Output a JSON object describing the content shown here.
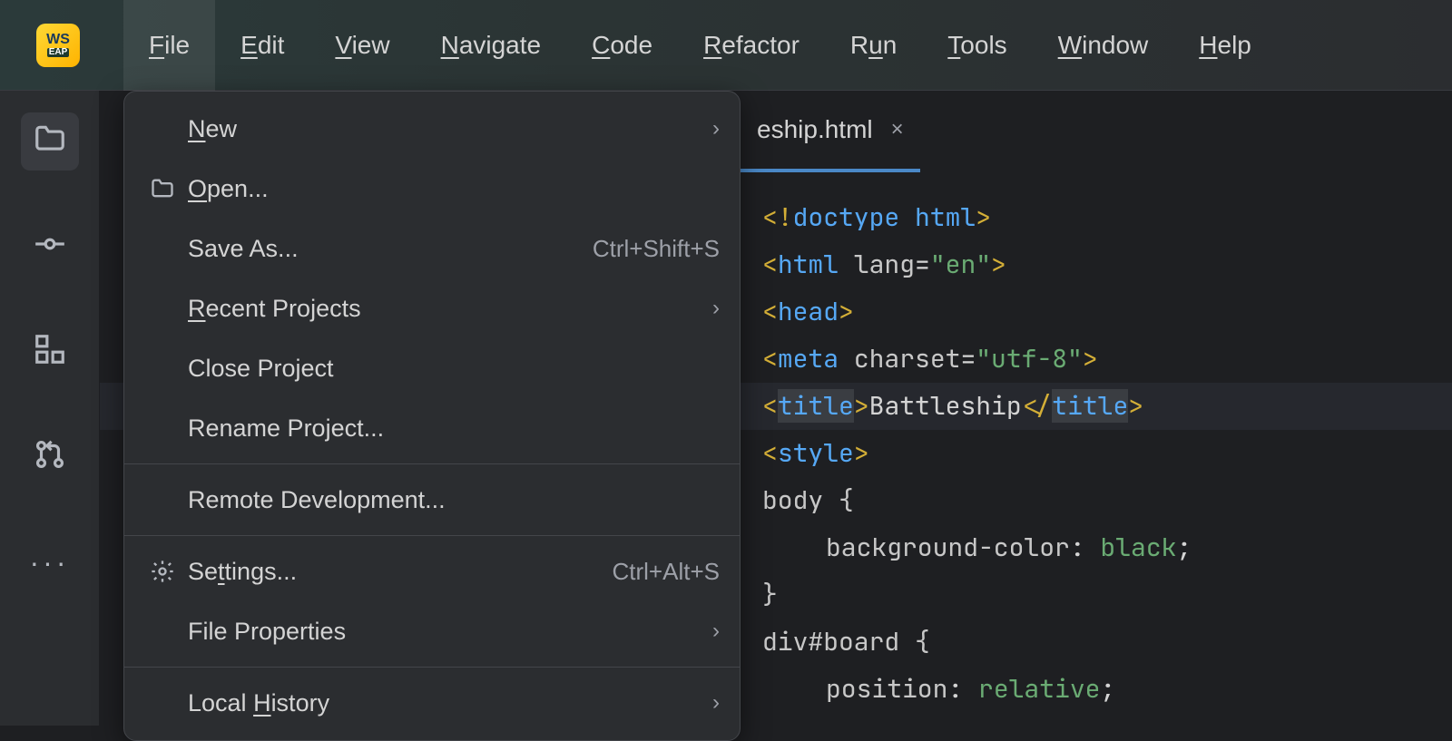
{
  "app": {
    "icon_top": "WS",
    "icon_bottom": "EAP"
  },
  "menubar": [
    {
      "pre": "",
      "u": "F",
      "post": "ile",
      "active": true
    },
    {
      "pre": "",
      "u": "E",
      "post": "dit"
    },
    {
      "pre": "",
      "u": "V",
      "post": "iew"
    },
    {
      "pre": "",
      "u": "N",
      "post": "avigate"
    },
    {
      "pre": "",
      "u": "C",
      "post": "ode"
    },
    {
      "pre": "",
      "u": "R",
      "post": "efactor"
    },
    {
      "pre": "R",
      "u": "u",
      "post": "n"
    },
    {
      "pre": "",
      "u": "T",
      "post": "ools"
    },
    {
      "pre": "",
      "u": "W",
      "post": "indow"
    },
    {
      "pre": "",
      "u": "H",
      "post": "elp"
    }
  ],
  "dropdown": {
    "groups": [
      [
        {
          "pre": "",
          "u": "N",
          "post": "ew",
          "submenu": true
        },
        {
          "pre": "",
          "u": "O",
          "post": "pen...",
          "icon": "folder"
        },
        {
          "pre": "Save As...",
          "u": "",
          "post": "",
          "shortcut": "Ctrl+Shift+S"
        },
        {
          "pre": "",
          "u": "R",
          "post": "ecent Projects",
          "submenu": true
        },
        {
          "pre": "Close Project",
          "u": "",
          "post": ""
        },
        {
          "pre": "Rename Project...",
          "u": "",
          "post": ""
        }
      ],
      [
        {
          "pre": "Remote Development...",
          "u": "",
          "post": ""
        }
      ],
      [
        {
          "pre": "Se",
          "u": "t",
          "post": "tings...",
          "icon": "gear",
          "shortcut": "Ctrl+Alt+S"
        },
        {
          "pre": "File Properties",
          "u": "",
          "post": "",
          "submenu": true
        }
      ],
      [
        {
          "pre": "Local ",
          "u": "H",
          "post": "istory",
          "submenu": true
        }
      ]
    ]
  },
  "tab": {
    "label": "eship.html",
    "close": "×"
  },
  "code": {
    "l1_doctype": "doctype html",
    "l2_tag": "html",
    "l2_attr": "lang",
    "l2_val": "\"en\"",
    "l3_tag": "head",
    "l4_tag": "meta",
    "l4_attr": "charset",
    "l4_val": "\"utf-8\"",
    "l5_tag": "title",
    "l5_text": "Battleship",
    "l6_tag": "style",
    "l7_sel": "body {",
    "l8_prop": "background-color",
    "l8_val": "black",
    "l9": "}",
    "l10_sel": "div#board {",
    "l11_prop": "position",
    "l11_val": "relative"
  }
}
